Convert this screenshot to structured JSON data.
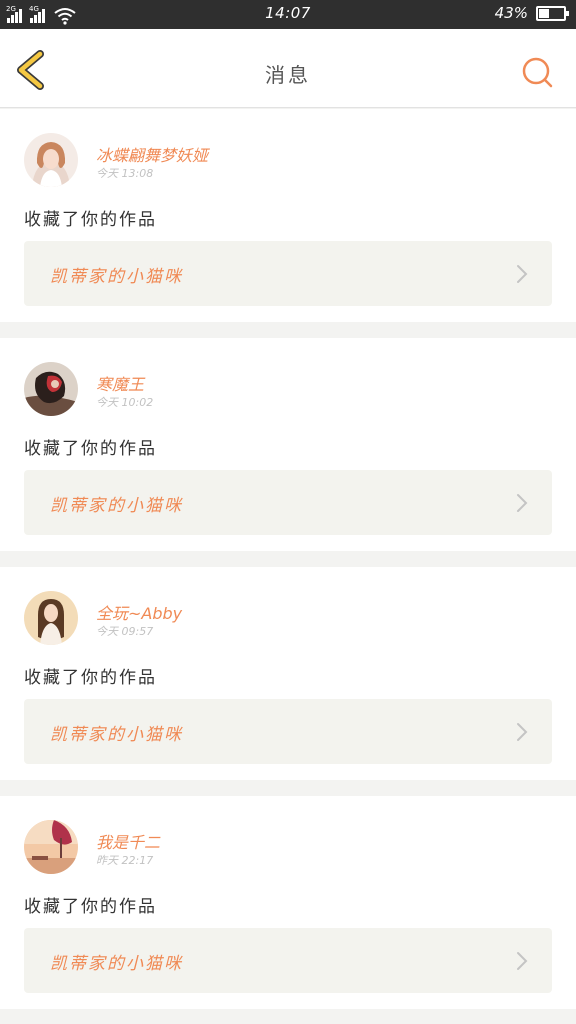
{
  "status_bar": {
    "network1": "2G",
    "network2": "4G",
    "time": "14:07",
    "battery_percent": "43%",
    "battery_level": 0.43,
    "icons": [
      "signal-icon",
      "signal-icon",
      "wifi-icon",
      "battery-icon"
    ]
  },
  "header": {
    "title": "消息",
    "back_icon": "chevron-left-icon",
    "search_icon": "search-icon",
    "accent_color": "#f08a55",
    "back_color": "#f5c842"
  },
  "messages": [
    {
      "name": "冰蝶翩舞梦妖娅",
      "time": "今天 13:08",
      "text": "收藏了你的作品",
      "work_title": "凯蒂家的小猫咪"
    },
    {
      "name": "寒魔王",
      "time": "今天 10:02",
      "text": "收藏了你的作品",
      "work_title": "凯蒂家的小猫咪"
    },
    {
      "name": "全玩~Abby",
      "time": "今天 09:57",
      "text": "收藏了你的作品",
      "work_title": "凯蒂家的小猫咪"
    },
    {
      "name": "我是千二",
      "time": "昨天 22:17",
      "text": "收藏了你的作品",
      "work_title": "凯蒂家的小猫咪"
    }
  ]
}
